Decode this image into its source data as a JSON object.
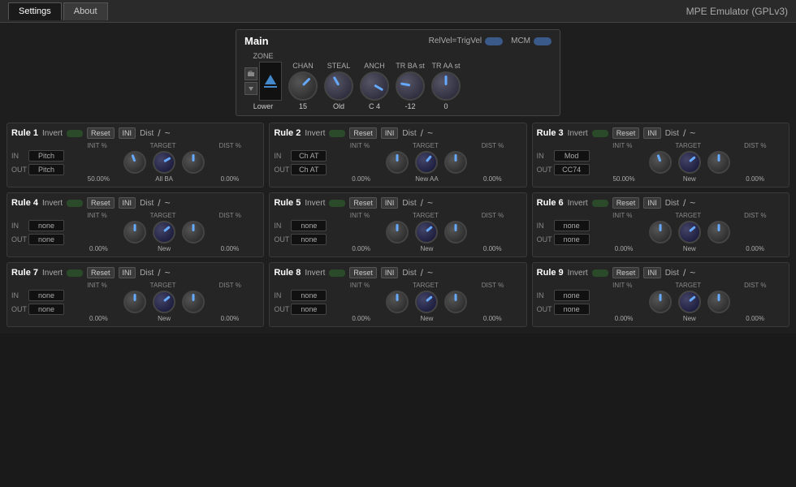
{
  "titleBar": {
    "title": "MPE Emulator (GPLv3)"
  },
  "tabs": [
    {
      "label": "Settings",
      "active": true
    },
    {
      "label": "About",
      "active": false
    }
  ],
  "mainPanel": {
    "title": "Main",
    "relVelToggle": "RelVel=TrigVel",
    "mcmLabel": "MCM",
    "columns": [
      "ZONE",
      "CHAN",
      "STEAL",
      "ANCH",
      "TR BA st",
      "TR AA st"
    ],
    "values": [
      "Lower",
      "15",
      "Old",
      "C 4",
      "-12",
      "0"
    ]
  },
  "rules": [
    {
      "id": "Rule 1",
      "invertLabel": "Invert",
      "resetLabel": "Reset",
      "iniLabel": "INI",
      "distLabel": "Dist",
      "inValue": "Pitch",
      "outValue": "Pitch",
      "initPct": "50.00%",
      "targetVal": "All BA",
      "distPct": "0.00%",
      "knob1Rot": "-20deg",
      "knob2Rot": "60deg",
      "knob3Rot": "0deg"
    },
    {
      "id": "Rule 2",
      "invertLabel": "Invert",
      "resetLabel": "Reset",
      "iniLabel": "INI",
      "distLabel": "Dist",
      "inValue": "Ch AT",
      "outValue": "Ch AT",
      "initPct": "0.00%",
      "targetVal": "New AA",
      "distPct": "0.00%",
      "knob1Rot": "0deg",
      "knob2Rot": "40deg",
      "knob3Rot": "0deg"
    },
    {
      "id": "Rule 3",
      "invertLabel": "Invert",
      "resetLabel": "Reset",
      "iniLabel": "INI",
      "distLabel": "Dist",
      "inValue": "Mod",
      "outValue": "CC74",
      "initPct": "50.00%",
      "targetVal": "New",
      "distPct": "0.00%",
      "knob1Rot": "-20deg",
      "knob2Rot": "50deg",
      "knob3Rot": "0deg"
    },
    {
      "id": "Rule 4",
      "invertLabel": "Invert",
      "resetLabel": "Reset",
      "iniLabel": "INI",
      "distLabel": "Dist",
      "inValue": "none",
      "outValue": "none",
      "initPct": "0.00%",
      "targetVal": "New",
      "distPct": "0.00%",
      "knob1Rot": "0deg",
      "knob2Rot": "50deg",
      "knob3Rot": "0deg"
    },
    {
      "id": "Rule 5",
      "invertLabel": "Invert",
      "resetLabel": "Reset",
      "iniLabel": "INI",
      "distLabel": "Dist",
      "inValue": "none",
      "outValue": "none",
      "initPct": "0.00%",
      "targetVal": "New",
      "distPct": "0.00%",
      "knob1Rot": "0deg",
      "knob2Rot": "50deg",
      "knob3Rot": "0deg"
    },
    {
      "id": "Rule 6",
      "invertLabel": "Invert",
      "resetLabel": "Reset",
      "iniLabel": "INI",
      "distLabel": "Dist",
      "inValue": "none",
      "outValue": "none",
      "initPct": "0.00%",
      "targetVal": "New",
      "distPct": "0.00%",
      "knob1Rot": "0deg",
      "knob2Rot": "50deg",
      "knob3Rot": "0deg"
    },
    {
      "id": "Rule 7",
      "invertLabel": "Invert",
      "resetLabel": "Reset",
      "iniLabel": "INI",
      "distLabel": "Dist",
      "inValue": "none",
      "outValue": "none",
      "initPct": "0.00%",
      "targetVal": "New",
      "distPct": "0.00%",
      "knob1Rot": "0deg",
      "knob2Rot": "50deg",
      "knob3Rot": "0deg"
    },
    {
      "id": "Rule 8",
      "invertLabel": "Invert",
      "resetLabel": "Reset",
      "iniLabel": "INI",
      "distLabel": "Dist",
      "inValue": "none",
      "outValue": "none",
      "initPct": "0.00%",
      "targetVal": "New",
      "distPct": "0.00%",
      "knob1Rot": "0deg",
      "knob2Rot": "50deg",
      "knob3Rot": "0deg"
    },
    {
      "id": "Rule 9",
      "invertLabel": "Invert",
      "resetLabel": "Reset",
      "iniLabel": "INI",
      "distLabel": "Dist",
      "inValue": "none",
      "outValue": "none",
      "initPct": "0.00%",
      "targetVal": "New",
      "distPct": "0.00%",
      "knob1Rot": "0deg",
      "knob2Rot": "50deg",
      "knob3Rot": "0deg"
    }
  ],
  "colors": {
    "bg": "#1a1a1a",
    "panelBg": "#252525",
    "accent": "#4488cc",
    "knobBlue": "#44aaff",
    "knobOrange": "#ffaa44"
  }
}
